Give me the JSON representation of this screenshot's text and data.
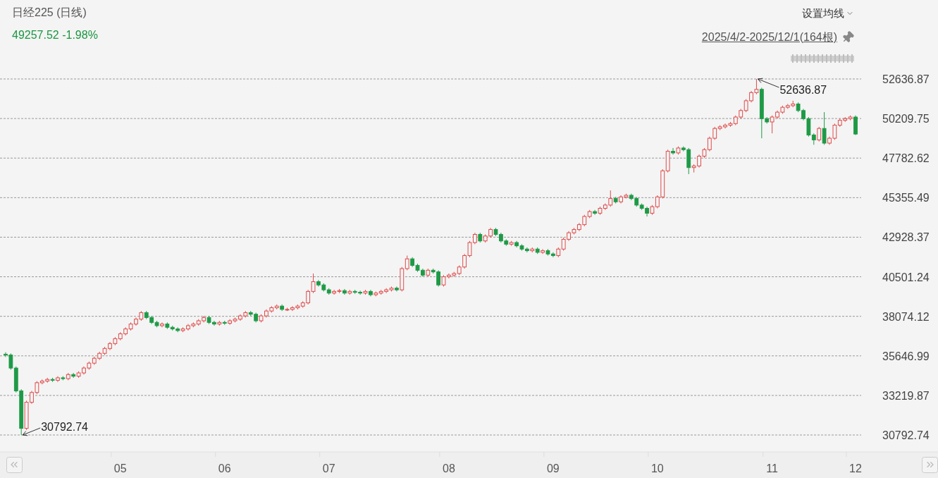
{
  "header": {
    "title": "日经225 (日线)",
    "quote": "49257.52 -1.98%",
    "ma_setting": "设置均线",
    "date_range": "2025/4/2-2025/12/1(164根)"
  },
  "chart": {
    "chart_data": {
      "type": "candlestick",
      "grid": true,
      "ylim": [
        30792.74,
        52636.87
      ],
      "categories": [
        null,
        null,
        null,
        null,
        null,
        null,
        null,
        null,
        null,
        null,
        null,
        null,
        null,
        null,
        null,
        null,
        null,
        null,
        null,
        null,
        null,
        null,
        "05",
        null,
        null,
        null,
        null,
        null,
        null,
        null,
        null,
        null,
        null,
        null,
        null,
        null,
        null,
        null,
        null,
        null,
        null,
        null,
        "06",
        null,
        null,
        null,
        null,
        null,
        null,
        null,
        null,
        null,
        null,
        null,
        null,
        null,
        null,
        null,
        null,
        null,
        null,
        null,
        "07",
        null,
        null,
        null,
        null,
        null,
        null,
        null,
        null,
        null,
        null,
        null,
        null,
        null,
        null,
        null,
        null,
        null,
        null,
        null,
        null,
        null,
        null,
        "08",
        null,
        null,
        null,
        null,
        null,
        null,
        null,
        null,
        null,
        null,
        null,
        null,
        null,
        null,
        null,
        null,
        null,
        null,
        null,
        "09",
        null,
        null,
        null,
        null,
        null,
        null,
        null,
        null,
        null,
        null,
        null,
        null,
        null,
        null,
        null,
        null,
        null,
        null,
        null,
        "10",
        null,
        null,
        null,
        null,
        null,
        null,
        null,
        null,
        null,
        null,
        null,
        null,
        null,
        null,
        null,
        null,
        null,
        null,
        null,
        null,
        null,
        "11",
        null,
        null,
        null,
        null,
        null,
        null,
        null,
        null,
        null,
        null,
        null,
        null,
        null,
        null,
        null,
        "12"
      ],
      "yticks": [
        {
          "value": 52636.87,
          "label": "52636.87"
        },
        {
          "value": 50209.75,
          "label": "50209.75"
        },
        {
          "value": 47782.62,
          "label": "47782.62"
        },
        {
          "value": 45355.49,
          "label": "45355.49"
        },
        {
          "value": 42928.37,
          "label": "42928.37"
        },
        {
          "value": 40501.24,
          "label": "40501.24"
        },
        {
          "value": 38074.12,
          "label": "38074.12"
        },
        {
          "value": 35646.99,
          "label": "35646.99"
        },
        {
          "value": 33219.87,
          "label": "33219.87"
        },
        {
          "value": 30792.74,
          "label": "30792.74"
        }
      ],
      "annotations": [
        "52636.87",
        "30792.74"
      ],
      "ohlc": [
        [
          35750,
          35870,
          35580,
          35700
        ],
        [
          35700,
          35800,
          34800,
          34900
        ],
        [
          34900,
          35000,
          33400,
          33500
        ],
        [
          33500,
          33600,
          30792.74,
          31200
        ],
        [
          31200,
          32900,
          31100,
          32800
        ],
        [
          32800,
          33500,
          32700,
          33400
        ],
        [
          33400,
          34100,
          33300,
          34000
        ],
        [
          34000,
          34200,
          33900,
          34100
        ],
        [
          34100,
          34300,
          34000,
          34200
        ],
        [
          34200,
          34300,
          34050,
          34150
        ],
        [
          34150,
          34400,
          34050,
          34300
        ],
        [
          34300,
          34400,
          34150,
          34250
        ],
        [
          34250,
          34600,
          34150,
          34500
        ],
        [
          34500,
          34600,
          34300,
          34400
        ],
        [
          34400,
          34700,
          34300,
          34600
        ],
        [
          34600,
          35000,
          34500,
          34900
        ],
        [
          34900,
          35300,
          34800,
          35200
        ],
        [
          35200,
          35600,
          35100,
          35500
        ],
        [
          35500,
          35900,
          35400,
          35800
        ],
        [
          35800,
          36200,
          35700,
          36100
        ],
        [
          36100,
          36500,
          36000,
          36400
        ],
        [
          36400,
          36800,
          36300,
          36700
        ],
        [
          36700,
          37100,
          36600,
          37000
        ],
        [
          37000,
          37400,
          36900,
          37300
        ],
        [
          37300,
          37700,
          37200,
          37600
        ],
        [
          37600,
          38000,
          37500,
          37900
        ],
        [
          37900,
          38400,
          37800,
          38300
        ],
        [
          38300,
          38400,
          37900,
          38000
        ],
        [
          38000,
          38100,
          37600,
          37700
        ],
        [
          37700,
          37800,
          37400,
          37500
        ],
        [
          37500,
          37700,
          37400,
          37600
        ],
        [
          37600,
          37700,
          37300,
          37400
        ],
        [
          37400,
          37500,
          37200,
          37300
        ],
        [
          37300,
          37400,
          37100,
          37200
        ],
        [
          37200,
          37400,
          37100,
          37300
        ],
        [
          37300,
          37600,
          37200,
          37500
        ],
        [
          37500,
          37700,
          37400,
          37600
        ],
        [
          37600,
          37900,
          37500,
          37800
        ],
        [
          37800,
          38100,
          37700,
          38000
        ],
        [
          38000,
          38100,
          37600,
          37700
        ],
        [
          37700,
          37800,
          37500,
          37600
        ],
        [
          37600,
          37800,
          37500,
          37700
        ],
        [
          37700,
          37800,
          37550,
          37650
        ],
        [
          37650,
          37900,
          37550,
          37800
        ],
        [
          37800,
          38000,
          37700,
          37900
        ],
        [
          37900,
          38200,
          37800,
          38100
        ],
        [
          38100,
          38400,
          38000,
          38300
        ],
        [
          38300,
          38400,
          38100,
          38200
        ],
        [
          38200,
          38300,
          37700,
          37800
        ],
        [
          37800,
          38200,
          37700,
          38100
        ],
        [
          38100,
          38500,
          38000,
          38400
        ],
        [
          38400,
          38700,
          38300,
          38600
        ],
        [
          38600,
          38800,
          38500,
          38700
        ],
        [
          38700,
          38800,
          38400,
          38500
        ],
        [
          38500,
          38600,
          38400,
          38500
        ],
        [
          38500,
          38700,
          38400,
          38600
        ],
        [
          38600,
          38800,
          38500,
          38700
        ],
        [
          38700,
          39000,
          38600,
          38900
        ],
        [
          38900,
          39700,
          38800,
          39600
        ],
        [
          39600,
          40700,
          39500,
          40200
        ],
        [
          40200,
          40300,
          39900,
          40000
        ],
        [
          40000,
          40100,
          39600,
          39700
        ],
        [
          39700,
          39800,
          39400,
          39500
        ],
        [
          39500,
          39700,
          39400,
          39600
        ],
        [
          39600,
          39750,
          39500,
          39650
        ],
        [
          39650,
          39750,
          39400,
          39500
        ],
        [
          39500,
          39700,
          39400,
          39600
        ],
        [
          39600,
          39700,
          39450,
          39550
        ],
        [
          39550,
          39650,
          39400,
          39500
        ],
        [
          39500,
          39700,
          39400,
          39600
        ],
        [
          39600,
          39700,
          39300,
          39400
        ],
        [
          39400,
          39600,
          39300,
          39500
        ],
        [
          39500,
          39700,
          39400,
          39600
        ],
        [
          39600,
          39800,
          39500,
          39700
        ],
        [
          39700,
          39900,
          39600,
          39800
        ],
        [
          39800,
          39900,
          39600,
          39700
        ],
        [
          39700,
          41100,
          39600,
          41000
        ],
        [
          41000,
          41800,
          40900,
          41600
        ],
        [
          41600,
          41700,
          41100,
          41200
        ],
        [
          41200,
          41300,
          40800,
          40900
        ],
        [
          40900,
          41000,
          40500,
          40600
        ],
        [
          40600,
          41000,
          40500,
          40900
        ],
        [
          40900,
          41000,
          40700,
          40800
        ],
        [
          40800,
          40900,
          39900,
          40000
        ],
        [
          40000,
          40600,
          39900,
          40500
        ],
        [
          40500,
          40700,
          40400,
          40600
        ],
        [
          40600,
          40800,
          40500,
          40700
        ],
        [
          40700,
          41200,
          40600,
          41100
        ],
        [
          41100,
          41900,
          41000,
          41800
        ],
        [
          41800,
          42700,
          41700,
          42600
        ],
        [
          42600,
          43200,
          42500,
          43100
        ],
        [
          43100,
          43200,
          42600,
          42700
        ],
        [
          42700,
          43100,
          42600,
          43000
        ],
        [
          43000,
          43500,
          42900,
          43400
        ],
        [
          43400,
          43500,
          43000,
          43100
        ],
        [
          43100,
          43200,
          42600,
          42700
        ],
        [
          42700,
          42800,
          42400,
          42500
        ],
        [
          42500,
          42700,
          42400,
          42600
        ],
        [
          42600,
          42700,
          42300,
          42400
        ],
        [
          42400,
          42500,
          42100,
          42200
        ],
        [
          42200,
          42300,
          42000,
          42100
        ],
        [
          42100,
          42300,
          42000,
          42200
        ],
        [
          42200,
          42300,
          41900,
          42000
        ],
        [
          42000,
          42200,
          41900,
          42100
        ],
        [
          42100,
          42200,
          41800,
          41900
        ],
        [
          41900,
          42000,
          41700,
          41800
        ],
        [
          41800,
          42300,
          41700,
          42200
        ],
        [
          42200,
          42900,
          42100,
          42800
        ],
        [
          42800,
          43300,
          42700,
          43200
        ],
        [
          43200,
          43500,
          43100,
          43400
        ],
        [
          43400,
          43800,
          43300,
          43700
        ],
        [
          43700,
          44300,
          43600,
          44200
        ],
        [
          44200,
          44600,
          44100,
          44500
        ],
        [
          44500,
          44600,
          44300,
          44400
        ],
        [
          44400,
          44800,
          44300,
          44700
        ],
        [
          44700,
          45000,
          44600,
          44900
        ],
        [
          44900,
          45800,
          44800,
          45300
        ],
        [
          45300,
          45400,
          45000,
          45100
        ],
        [
          45100,
          45500,
          45000,
          45400
        ],
        [
          45400,
          45600,
          45300,
          45500
        ],
        [
          45500,
          45600,
          45200,
          45300
        ],
        [
          45300,
          45400,
          44800,
          44900
        ],
        [
          44900,
          45000,
          44600,
          44700
        ],
        [
          44700,
          44800,
          44200,
          44400
        ],
        [
          44400,
          44900,
          44300,
          44800
        ],
        [
          44800,
          45500,
          44700,
          45400
        ],
        [
          45400,
          47100,
          45300,
          47000
        ],
        [
          47000,
          48300,
          46900,
          48200
        ],
        [
          48200,
          48400,
          48000,
          48100
        ],
        [
          48100,
          48500,
          48000,
          48400
        ],
        [
          48400,
          48500,
          48200,
          48300
        ],
        [
          48300,
          48400,
          46800,
          47200
        ],
        [
          47200,
          47400,
          46900,
          47300
        ],
        [
          47300,
          48000,
          47200,
          47900
        ],
        [
          47900,
          48400,
          47800,
          48300
        ],
        [
          48300,
          49100,
          48200,
          49000
        ],
        [
          49000,
          49700,
          48900,
          49600
        ],
        [
          49600,
          49800,
          49500,
          49700
        ],
        [
          49700,
          49900,
          49600,
          49800
        ],
        [
          49800,
          50000,
          49700,
          49900
        ],
        [
          49900,
          50400,
          49800,
          50300
        ],
        [
          50300,
          50800,
          50200,
          50700
        ],
        [
          50700,
          51400,
          50600,
          51300
        ],
        [
          51300,
          51900,
          51200,
          51800
        ],
        [
          51800,
          52636.87,
          51700,
          52000
        ],
        [
          52000,
          52100,
          49000,
          50200
        ],
        [
          50200,
          50300,
          49900,
          50000
        ],
        [
          50000,
          50400,
          49300,
          50300
        ],
        [
          50300,
          50700,
          50200,
          50600
        ],
        [
          50600,
          51000,
          50500,
          50900
        ],
        [
          50900,
          51100,
          50800,
          51000
        ],
        [
          51000,
          51300,
          50900,
          51100
        ],
        [
          51100,
          51200,
          50600,
          50700
        ],
        [
          50700,
          50800,
          50100,
          50200
        ],
        [
          50200,
          50300,
          49100,
          49200
        ],
        [
          49200,
          49300,
          48600,
          48900
        ],
        [
          48900,
          49700,
          48800,
          49600
        ],
        [
          49600,
          50600,
          48600,
          48700
        ],
        [
          48700,
          49100,
          48600,
          49000
        ],
        [
          49000,
          49900,
          48900,
          49800
        ],
        [
          49800,
          50200,
          49700,
          50100
        ],
        [
          50100,
          50300,
          50000,
          50200
        ],
        [
          50200,
          50400,
          50100,
          50300
        ],
        [
          50300,
          50400,
          49200,
          49257.52
        ]
      ]
    }
  }
}
